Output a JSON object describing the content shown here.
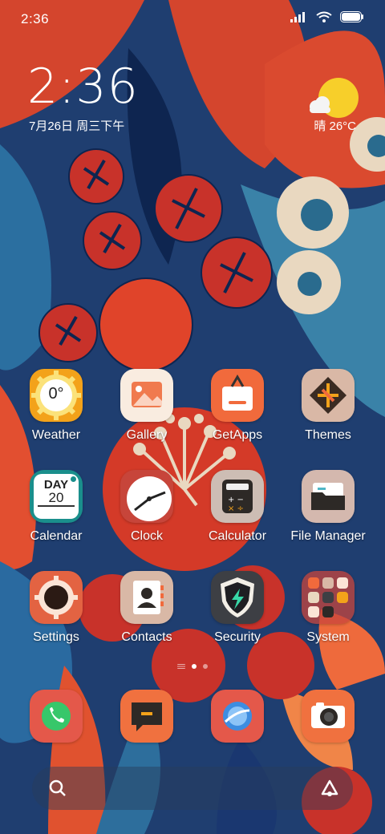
{
  "status_bar": {
    "time": "2:36"
  },
  "clock_widget": {
    "time": "2:36",
    "date": "7月26日 周三下午"
  },
  "weather_widget": {
    "condition_temp": "晴 26°C"
  },
  "apps": [
    {
      "label": "Weather",
      "icon": "weather-sun-icon",
      "tile_text": "0°"
    },
    {
      "label": "Gallery",
      "icon": "gallery-icon"
    },
    {
      "label": "GetApps",
      "icon": "getapps-bag-icon"
    },
    {
      "label": "Themes",
      "icon": "themes-icon"
    },
    {
      "label": "Calendar",
      "icon": "calendar-icon",
      "tile_day": "DAY",
      "tile_num": "20"
    },
    {
      "label": "Clock",
      "icon": "clock-icon"
    },
    {
      "label": "Calculator",
      "icon": "calculator-icon"
    },
    {
      "label": "File Manager",
      "icon": "folder-icon"
    },
    {
      "label": "Settings",
      "icon": "gear-icon"
    },
    {
      "label": "Contacts",
      "icon": "contacts-icon"
    },
    {
      "label": "Security",
      "icon": "shield-icon"
    },
    {
      "label": "System",
      "icon": "folder-grid-icon"
    }
  ],
  "dock": [
    {
      "label": "Phone",
      "icon": "phone-icon"
    },
    {
      "label": "Messages",
      "icon": "message-icon"
    },
    {
      "label": "Browser",
      "icon": "browser-icon"
    },
    {
      "label": "Camera",
      "icon": "camera-icon"
    }
  ],
  "page_indicator": {
    "pages": 2,
    "active": 1
  },
  "colors": {
    "accent_orange": "#e96a3a",
    "accent_red": "#d9432b",
    "sun_yellow": "#f7cf2a"
  }
}
